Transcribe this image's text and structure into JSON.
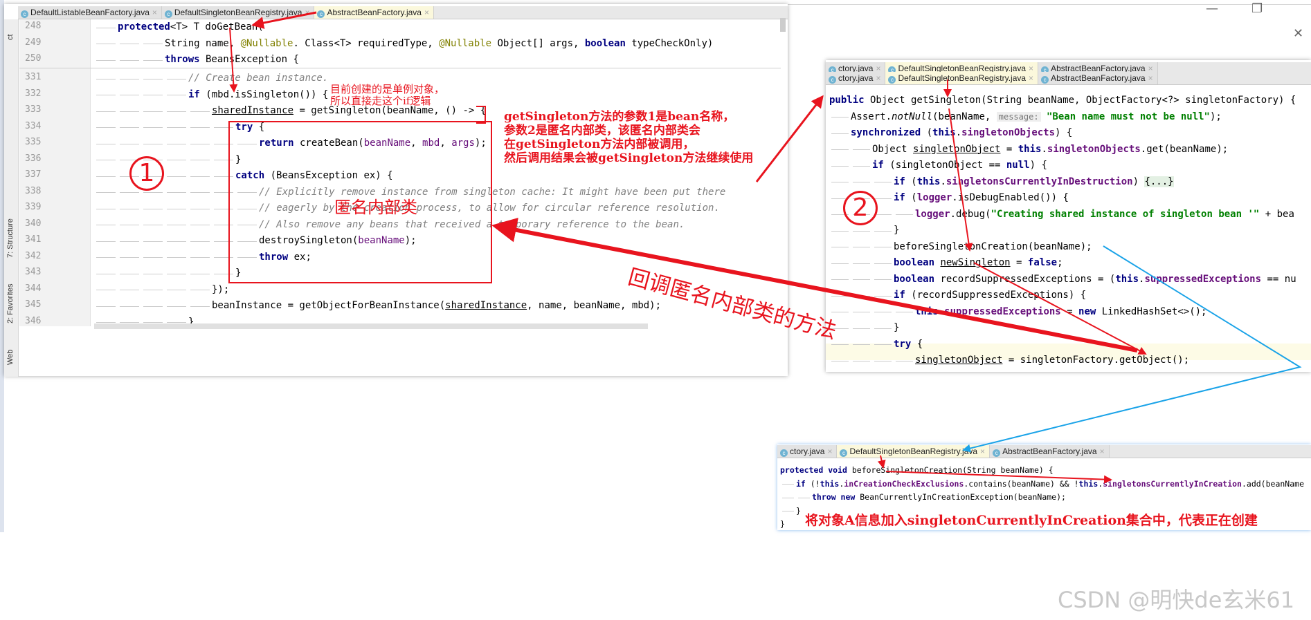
{
  "window_controls": {
    "minimize": "—",
    "restore": "❐",
    "close": "✕"
  },
  "sidebar": {
    "items": [
      "ct",
      "7: Structure",
      "2: Favorites",
      "Web"
    ]
  },
  "editor1": {
    "tabs": [
      {
        "label": "DefaultListableBeanFactory.java",
        "active": false
      },
      {
        "label": "DefaultSingletonBeanRegistry.java",
        "active": false
      },
      {
        "label": "AbstractBeanFactory.java",
        "active": true
      }
    ],
    "sticky_lines": [
      {
        "no": "248",
        "indent": 1,
        "tokens": [
          [
            "kw",
            "protected"
          ],
          [
            "",
            "<T> T doGetBean("
          ]
        ]
      },
      {
        "no": "249",
        "indent": 3,
        "tokens": [
          [
            "",
            "String name, "
          ],
          [
            "an",
            "@Nullable"
          ],
          [
            "",
            ". Class<T> requiredType, "
          ],
          [
            "an",
            "@Nullable"
          ],
          [
            "",
            " Object[] args, "
          ],
          [
            "kw",
            "boolean"
          ],
          [
            "",
            " typeCheckOnly)"
          ]
        ]
      },
      {
        "no": "250",
        "indent": 3,
        "tokens": [
          [
            "kw",
            "throws"
          ],
          [
            "",
            " BeansException {"
          ]
        ]
      }
    ],
    "lines": [
      {
        "no": "331",
        "indent": 4,
        "tokens": [
          [
            "cm",
            "// Create bean instance."
          ]
        ]
      },
      {
        "no": "332",
        "indent": 4,
        "tokens": [
          [
            "kw",
            "if"
          ],
          [
            "",
            " (mbd.isSingleton()) {"
          ]
        ]
      },
      {
        "no": "333",
        "indent": 5,
        "tokens": [
          [
            "ul",
            "sharedInstance"
          ],
          [
            "",
            " = getSingleton(beanName, () -> {"
          ]
        ]
      },
      {
        "no": "334",
        "indent": 6,
        "tokens": [
          [
            "kw",
            "try"
          ],
          [
            "",
            " {"
          ]
        ]
      },
      {
        "no": "335",
        "indent": 7,
        "tokens": [
          [
            "kw",
            "return"
          ],
          [
            "",
            " createBean("
          ],
          [
            "par",
            "beanName"
          ],
          [
            "",
            ", "
          ],
          [
            "par",
            "mbd"
          ],
          [
            "",
            ", "
          ],
          [
            "par",
            "args"
          ],
          [
            "",
            ");"
          ]
        ]
      },
      {
        "no": "336",
        "indent": 6,
        "tokens": [
          [
            "",
            "}"
          ]
        ]
      },
      {
        "no": "337",
        "indent": 6,
        "tokens": [
          [
            "kw",
            "catch"
          ],
          [
            "",
            " (BeansException ex) {"
          ]
        ]
      },
      {
        "no": "338",
        "indent": 7,
        "tokens": [
          [
            "cm",
            "// Explicitly remove instance from singleton cache: It might have been put there"
          ]
        ]
      },
      {
        "no": "339",
        "indent": 7,
        "tokens": [
          [
            "cm",
            "// eagerly by the creation process, to allow for circular reference resolution."
          ]
        ]
      },
      {
        "no": "340",
        "indent": 7,
        "tokens": [
          [
            "cm",
            "// Also remove any beans that received a temporary reference to the bean."
          ]
        ]
      },
      {
        "no": "341",
        "indent": 7,
        "tokens": [
          [
            "",
            "destroySingleton("
          ],
          [
            "par",
            "beanName"
          ],
          [
            "",
            ");"
          ]
        ]
      },
      {
        "no": "342",
        "indent": 7,
        "tokens": [
          [
            "kw",
            "throw"
          ],
          [
            "",
            " ex;"
          ]
        ]
      },
      {
        "no": "343",
        "indent": 6,
        "tokens": [
          [
            "",
            "}"
          ]
        ]
      },
      {
        "no": "344",
        "indent": 5,
        "tokens": [
          [
            "",
            "});"
          ]
        ]
      },
      {
        "no": "345",
        "indent": 5,
        "tokens": [
          [
            "",
            "beanInstance = getObjectForBeanInstance("
          ],
          [
            "ul",
            "sharedInstance"
          ],
          [
            "",
            ", name, beanName, mbd);"
          ]
        ]
      },
      {
        "no": "346",
        "indent": 4,
        "tokens": [
          [
            "",
            "}"
          ]
        ]
      }
    ]
  },
  "editor2": {
    "tabs_row1": [
      {
        "label": "ctory.java",
        "active": false
      },
      {
        "label": "DefaultSingletonBeanRegistry.java",
        "active": true
      },
      {
        "label": "AbstractBeanFactory.java",
        "active": false
      }
    ],
    "tabs_row2": [
      {
        "label": "ctory.java",
        "active": false
      },
      {
        "label": "DefaultSingletonBeanRegistry.java",
        "active": true
      },
      {
        "label": "AbstractBeanFactory.java",
        "active": false
      }
    ],
    "lines": [
      {
        "indent": 0,
        "tokens": [
          [
            "kw",
            "public"
          ],
          [
            "",
            " Object getSingleton(String beanName, ObjectFactory<?> singletonFactory) {"
          ]
        ]
      },
      {
        "indent": 1,
        "tokens": [
          [
            "",
            "Assert."
          ],
          [
            "it",
            "notNull"
          ],
          [
            "",
            "(beanName, "
          ],
          [
            "hint",
            "message:"
          ],
          [
            "str",
            " \"Bean name must not be null\""
          ],
          [
            "",
            ");"
          ]
        ]
      },
      {
        "indent": 1,
        "tokens": [
          [
            "kw",
            "synchronized"
          ],
          [
            "",
            " ("
          ],
          [
            "kw",
            "this"
          ],
          [
            "",
            "."
          ],
          [
            "fld",
            "singletonObjects"
          ],
          [
            "",
            ") {"
          ]
        ]
      },
      {
        "indent": 2,
        "tokens": [
          [
            "",
            "Object "
          ],
          [
            "ul",
            "singletonObject"
          ],
          [
            "",
            " = "
          ],
          [
            "kw",
            "this"
          ],
          [
            "",
            "."
          ],
          [
            "fld",
            "singletonObjects"
          ],
          [
            "",
            ".get(beanName);"
          ]
        ]
      },
      {
        "indent": 2,
        "tokens": [
          [
            "kw",
            "if"
          ],
          [
            "",
            " (singletonObject == "
          ],
          [
            "kw",
            "null"
          ],
          [
            "",
            ") {"
          ]
        ]
      },
      {
        "indent": 3,
        "tokens": [
          [
            "kw",
            "if"
          ],
          [
            "",
            " ("
          ],
          [
            "kw",
            "this"
          ],
          [
            "",
            "."
          ],
          [
            "fld",
            "singletonsCurrentlyInDestruction"
          ],
          [
            "",
            ") "
          ],
          [
            "fold",
            "{...}"
          ]
        ]
      },
      {
        "indent": 3,
        "tokens": [
          [
            "kw",
            "if"
          ],
          [
            "",
            " ("
          ],
          [
            "fld",
            "logger"
          ],
          [
            "",
            ".isDebugEnabled()) {"
          ]
        ]
      },
      {
        "indent": 4,
        "tokens": [
          [
            "fld",
            "logger"
          ],
          [
            "",
            ".debug("
          ],
          [
            "str",
            "\"Creating shared instance of singleton bean '\""
          ],
          [
            "",
            " + bea"
          ]
        ]
      },
      {
        "indent": 3,
        "tokens": [
          [
            "",
            "}"
          ]
        ]
      },
      {
        "indent": 3,
        "tokens": [
          [
            "",
            "beforeSingletonCreation(beanName);"
          ]
        ]
      },
      {
        "indent": 3,
        "tokens": [
          [
            "kw",
            "boolean"
          ],
          [
            "",
            " "
          ],
          [
            "ul",
            "newSingleton"
          ],
          [
            "",
            " = "
          ],
          [
            "kw",
            "false"
          ],
          [
            "",
            ";"
          ]
        ]
      },
      {
        "indent": 3,
        "tokens": [
          [
            "kw",
            "boolean"
          ],
          [
            "",
            " recordSuppressedExceptions = ("
          ],
          [
            "kw",
            "this"
          ],
          [
            "",
            "."
          ],
          [
            "fld",
            "suppressedExceptions"
          ],
          [
            "",
            " == nu"
          ]
        ]
      },
      {
        "indent": 3,
        "tokens": [
          [
            "kw",
            "if"
          ],
          [
            "",
            " (recordSuppressedExceptions) {"
          ]
        ]
      },
      {
        "indent": 4,
        "tokens": [
          [
            "kw",
            "this"
          ],
          [
            "",
            "."
          ],
          [
            "fld",
            "suppressedExceptions"
          ],
          [
            "",
            " = "
          ],
          [
            "kw",
            "new"
          ],
          [
            "",
            " LinkedHashSet<>();"
          ]
        ]
      },
      {
        "indent": 3,
        "tokens": [
          [
            "",
            "}"
          ]
        ]
      },
      {
        "indent": 3,
        "tokens": [
          [
            "kw",
            "try"
          ],
          [
            "",
            " {"
          ]
        ]
      },
      {
        "indent": 4,
        "tokens": [
          [
            "ul",
            "singletonObject"
          ],
          [
            "",
            " = singletonFactory.getObject();"
          ]
        ]
      }
    ]
  },
  "editor3": {
    "tabs": [
      {
        "label": "ctory.java",
        "active": false
      },
      {
        "label": "DefaultSingletonBeanRegistry.java",
        "active": true
      },
      {
        "label": "AbstractBeanFactory.java",
        "active": false
      }
    ],
    "lines": [
      {
        "indent": 0,
        "tokens": [
          [
            "kw",
            "protected void"
          ],
          [
            "",
            " beforeSingletonCreation(String beanName) {"
          ]
        ]
      },
      {
        "indent": 1,
        "tokens": [
          [
            "kw",
            "if"
          ],
          [
            "",
            " (!"
          ],
          [
            "kw",
            "this"
          ],
          [
            "",
            "."
          ],
          [
            "fld",
            "inCreationCheckExclusions"
          ],
          [
            "",
            ".contains(beanName) && !"
          ],
          [
            "kw",
            "this"
          ],
          [
            "",
            "."
          ],
          [
            "fld",
            "singletonsCurrentlyInCreation"
          ],
          [
            "",
            ".add(beanName"
          ]
        ]
      },
      {
        "indent": 2,
        "tokens": [
          [
            "kw",
            "throw new"
          ],
          [
            "",
            " BeanCurrentlyInCreationException(beanName);"
          ]
        ]
      },
      {
        "indent": 1,
        "tokens": [
          [
            "",
            "}"
          ]
        ]
      },
      {
        "indent": 0,
        "tokens": [
          [
            "",
            "}"
          ]
        ]
      }
    ]
  },
  "annotations": {
    "singleton_note": "目前创建的是单例对象，\n所以直接走这个if逻辑",
    "params_note": "getSingleton方法的参数1是bean名称，\n参数2是匿名内部类，该匿名内部类会\n在getSingleton方法内部被调用，\n然后调用结果会被getSingleton方法继续使用",
    "circle1": "①",
    "anon_class": "匿名内部类",
    "callback_note": "回调匿名内部类的方法",
    "circle2": "②",
    "creation_note": "将对象A信息加入singletonCurrentlyInCreation集合中，代表正在创建"
  },
  "watermark": "CSDN @明快de玄米61",
  "colors": {
    "annotation_red": "#e8141e",
    "arrow_blue": "#1aa3e8"
  }
}
